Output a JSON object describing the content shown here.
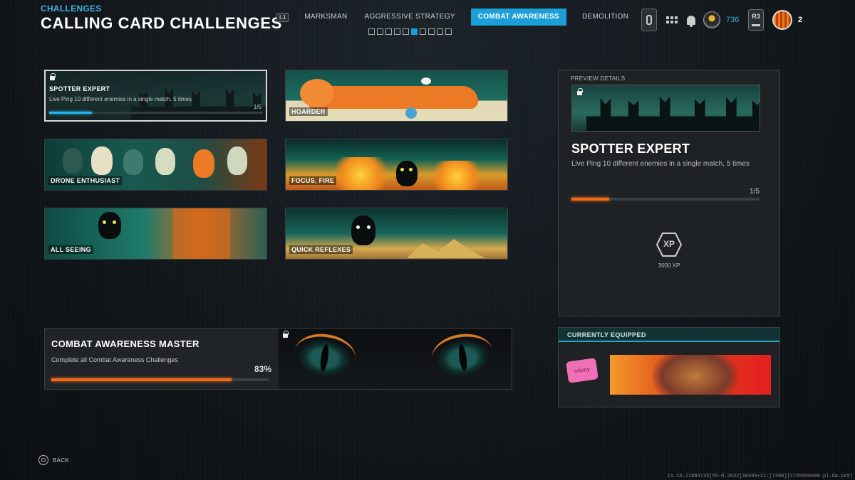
{
  "header": {
    "category": "CHALLENGES",
    "title": "CALLING CARD CHALLENGES",
    "bumper_left": "L1",
    "bumper_right": "R1",
    "tabs": [
      {
        "label": "MARKSMAN",
        "active": false
      },
      {
        "label": "AGGRESSIVE STRATEGY",
        "active": false
      },
      {
        "label": "COMBAT AWARENESS",
        "active": true
      },
      {
        "label": "DEMOLITION",
        "active": false
      }
    ],
    "page_dots": {
      "total": 10,
      "active_index": 5
    }
  },
  "topbar": {
    "currency": "736",
    "r3_label": "R3",
    "level": "2",
    "icons": [
      "controller-icon",
      "grid-menu-icon",
      "bell-icon",
      "emblem-icon",
      "avatar-icon"
    ]
  },
  "cards": [
    {
      "name": "SPOTTER EXPERT",
      "description": "Live Ping 10 different enemies in a single match, 5 times",
      "progress_text": "1/5",
      "progress": 0.2,
      "selected": true,
      "locked": true
    },
    {
      "name": "HOARDER",
      "locked": false
    },
    {
      "name": "DRONE ENTHUSIAST",
      "locked": false
    },
    {
      "name": "FOCUS, FIRE",
      "locked": false
    },
    {
      "name": "ALL SEEING",
      "locked": false
    },
    {
      "name": "QUICK REFLEXES",
      "locked": false
    }
  ],
  "master": {
    "title": "COMBAT AWARENESS MASTER",
    "description": "Complete all Combat Awareness Challenges",
    "percent_text": "83%",
    "progress": 0.83,
    "locked": true
  },
  "preview": {
    "header": "PREVIEW DETAILS",
    "title": "SPOTTER EXPERT",
    "description": "Live Ping 10 different enemies in a single match, 5 times",
    "progress_text": "1/5",
    "progress": 0.2,
    "xp_icon_label": "XP",
    "reward": "3000 XP"
  },
  "equipped": {
    "header": "CURRENTLY EQUIPPED",
    "emblem_text": "ohony"
  },
  "footer": {
    "back_label": "BACK",
    "build_info": "11.15.21884735[55-0.2832]10495+11:[7300][1745690400.pl.Ga.ps5]"
  },
  "colors": {
    "accent_blue": "#1a9fd8",
    "progress_orange": "#f06a1a",
    "progress_blue": "#27b3ea"
  }
}
